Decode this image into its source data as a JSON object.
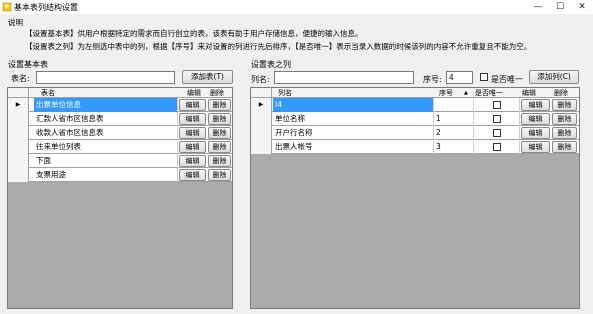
{
  "window": {
    "title": "基本表列结构设置",
    "minimize": "—",
    "maximize": "☐",
    "close": "✕"
  },
  "notes": {
    "heading": "说明",
    "line1": "【设置基本表】供用户根据特定的需求而自行创立的表，该表有助于用户存储信息，便捷的输入信息。",
    "line2": "【设置表之列】为左侧选中表中的列，根据【序号】来对设置的列进行先后排序，【是否唯一】表示当录入数据的时候该列的内容不允许重复且不能为空。"
  },
  "left": {
    "section_title": "设置基本表",
    "name_label": "表名:",
    "name_value": "",
    "add_button": "添加表(T)",
    "columns": [
      "表名",
      "编辑",
      "删除"
    ],
    "edit_label": "编辑",
    "delete_label": "删除",
    "row_marker": "▶",
    "rows": [
      {
        "name": "出票单位信息",
        "selected": true
      },
      {
        "name": "汇款人省市区信息表",
        "selected": false
      },
      {
        "name": "收款人省市区信息表",
        "selected": false
      },
      {
        "name": "往来单位列表",
        "selected": false
      },
      {
        "name": "下面",
        "selected": false
      },
      {
        "name": "支票用途",
        "selected": false
      }
    ]
  },
  "right": {
    "section_title": "设置表之列",
    "col_name_label": "列名:",
    "col_name_value": "",
    "seq_label": "序号:",
    "seq_value": "4",
    "unique_label": "是否唯一",
    "add_button": "添加列(C)",
    "columns": [
      "列名",
      "序号",
      "是否唯一",
      "编辑",
      "删除"
    ],
    "sort_glyph": "▲",
    "edit_label": "编辑",
    "delete_label": "删除",
    "row_marker": "▶",
    "rows": [
      {
        "name": "I4",
        "seq": "",
        "unique": false,
        "selected": true
      },
      {
        "name": "单位名称",
        "seq": "1",
        "unique": false,
        "selected": false
      },
      {
        "name": "开户行名称",
        "seq": "2",
        "unique": false,
        "selected": false
      },
      {
        "name": "出票人帐号",
        "seq": "3",
        "unique": false,
        "selected": false
      }
    ]
  }
}
